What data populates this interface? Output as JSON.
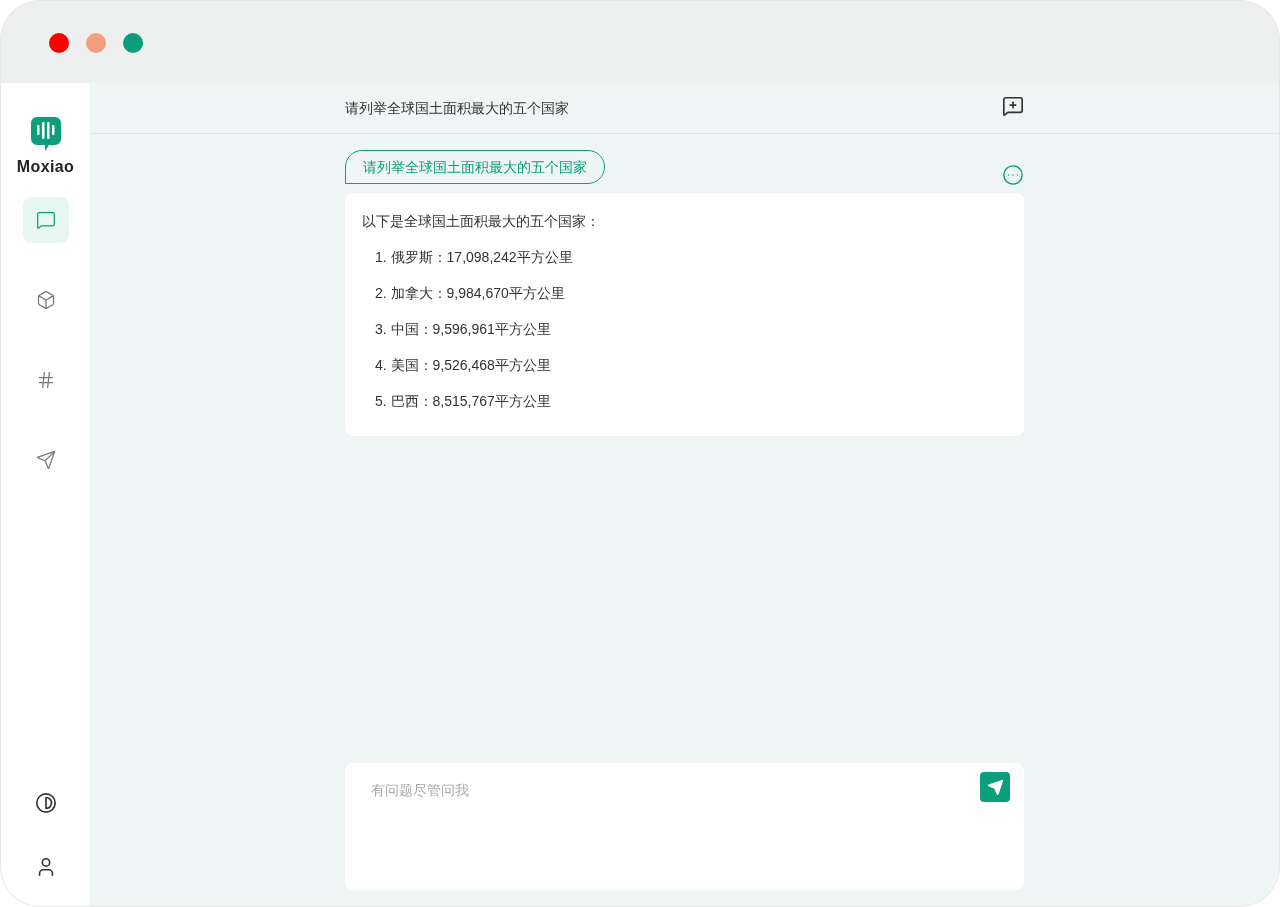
{
  "window_controls": [
    {
      "color": "#ff0000"
    },
    {
      "color": "#f29f7d"
    },
    {
      "color": "#0a9e7c"
    }
  ],
  "sidebar": {
    "logo_text": "Moxiao",
    "items": [
      {
        "kind": "chat",
        "selected": true
      },
      {
        "kind": "cube",
        "selected": false
      },
      {
        "kind": "hash",
        "selected": false
      },
      {
        "kind": "send",
        "selected": false
      }
    ],
    "bottom_items": [
      {
        "kind": "theme"
      },
      {
        "kind": "user"
      }
    ]
  },
  "header": {
    "title": "请列举全球国土面积最大的五个国家"
  },
  "conversation": {
    "question": "请列举全球国土面积最大的五个国家",
    "answer": {
      "intro": "以下是全球国土面积最大的五个国家：",
      "items": [
        "1. 俄罗斯：17,098,242平方公里",
        "2. 加拿大：9,984,670平方公里",
        "3. 中国：9,596,961平方公里",
        "4. 美国：9,526,468平方公里",
        "5. 巴西：8,515,767平方公里"
      ]
    }
  },
  "composer": {
    "placeholder": "有问题尽管问我"
  }
}
